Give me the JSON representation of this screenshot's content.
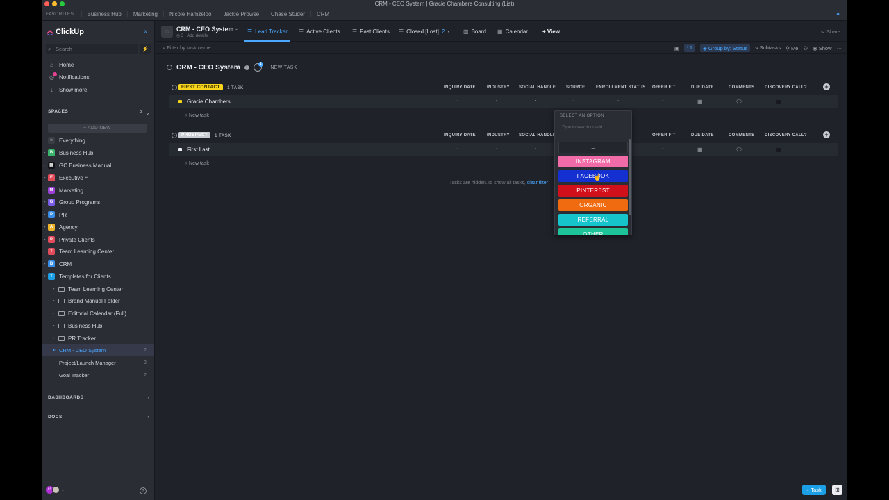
{
  "window_title": "CRM - CEO System | Gracie Chambers Consulting (List)",
  "favorites": {
    "label": "FAVORITES",
    "items": [
      "Business Hub",
      "Marketing",
      "Nicole Hamzeloo",
      "Jackie Prowse",
      "Chase Studer",
      "CRM"
    ]
  },
  "sidebar": {
    "logo": "ClickUp",
    "search_placeholder": "Search",
    "nav": [
      {
        "label": "Home",
        "icon": "home-icon"
      },
      {
        "label": "Notifications",
        "icon": "bell-icon"
      },
      {
        "label": "Show more",
        "icon": "chevron-down-icon"
      }
    ],
    "spaces_label": "SPACES",
    "add_new": "+ ADD NEW",
    "spaces": [
      {
        "label": "Everything",
        "badge": "",
        "color": "#393c44"
      },
      {
        "label": "Business Hub",
        "badge": "B",
        "color": "#3db46d"
      },
      {
        "label": "GC Business Manual",
        "badge": "",
        "color": "#1f2229"
      },
      {
        "label": "Executive",
        "badge": "E",
        "color": "#e24c5a"
      },
      {
        "label": "Marketing",
        "badge": "M",
        "color": "#9b3fd6"
      },
      {
        "label": "Group Programs",
        "badge": "G",
        "color": "#7b5ce6"
      },
      {
        "label": "PR",
        "badge": "P",
        "color": "#3a8ee6"
      },
      {
        "label": "Agency",
        "badge": "A",
        "color": "#f0b429"
      },
      {
        "label": "Private Clients",
        "badge": "P",
        "color": "#e24c5a"
      },
      {
        "label": "Team Learning Center",
        "badge": "T",
        "color": "#e24c5a"
      },
      {
        "label": "CRM",
        "badge": "B",
        "color": "#3a8ee6"
      },
      {
        "label": "Templates for Clients",
        "badge": "T",
        "color": "#1b9fe6"
      }
    ],
    "folders": [
      "Team Learning Center",
      "Brand Manual Folder",
      "Editorial Calendar (Full)",
      "Business Hub",
      "PR Tracker"
    ],
    "lists": [
      {
        "label": "CRM - CEO System",
        "count": "2"
      },
      {
        "label": "Project/Launch Manager",
        "count": "2"
      },
      {
        "label": "Goal Tracker",
        "count": "2"
      }
    ],
    "dashboards": "DASHBOARDS",
    "docs": "DOCS",
    "avatar": "G"
  },
  "topbar": {
    "title": "CRM - CEO System",
    "sub_count": "3",
    "sub_details": "Add details",
    "views": [
      {
        "label": "Lead Tracker",
        "icon": "list-icon"
      },
      {
        "label": "Active Clients",
        "icon": "list-icon"
      },
      {
        "label": "Past Clients",
        "icon": "list-icon"
      },
      {
        "label": "Closed [Lost]",
        "icon": "list-icon"
      },
      {
        "label": "Board",
        "icon": "board-icon"
      },
      {
        "label": "Calendar",
        "icon": "calendar-icon"
      }
    ],
    "closed_count": "2",
    "add_view": "+ View",
    "share": "Share"
  },
  "filterbar": {
    "placeholder": "Filter by task name...",
    "filter_count": "1",
    "group_by": "Group by: Status",
    "subtasks": "Subtasks",
    "me": "Me",
    "show": "Show"
  },
  "list": {
    "title": "CRM - CEO System",
    "watchers": "1",
    "new_task": "+ NEW TASK",
    "columns": [
      "INQUIRY DATE",
      "INDUSTRY",
      "SOCIAL HANDLE",
      "SOURCE",
      "ENROLLMENT STATUS",
      "OFFER FIT",
      "DUE DATE",
      "COMMENTS",
      "DISCOVERY CALL?"
    ],
    "groups": [
      {
        "status": "FIRST CONTACT",
        "color": "#f7d51d",
        "text_color": "#3a3000",
        "count": "1 TASK",
        "task": "Gracie Chambers",
        "task_color": "#f7d51d"
      },
      {
        "status": "PROSPECT",
        "color": "#c8cbd1",
        "text_color": "#ffffff",
        "count": "1 TASK",
        "task": "First Last",
        "task_color": "#eceef1"
      }
    ],
    "new_task_row": "+ New task",
    "hidden_note": "Tasks are hidden.To show all tasks,",
    "clear_filter": "clear filter",
    "dash": "-"
  },
  "dropdown": {
    "title": "SELECT AN OPTION",
    "placeholder": "Type to search or add...",
    "none_option": "–",
    "options": [
      {
        "label": "INSTAGRAM",
        "color": "#f06ba8"
      },
      {
        "label": "FACEBOOK",
        "color": "#1530d0"
      },
      {
        "label": "PINTEREST",
        "color": "#d0101a"
      },
      {
        "label": "ORGANIC",
        "color": "#f06a0f"
      },
      {
        "label": "REFERRAL",
        "color": "#16c5cc"
      },
      {
        "label": "OTHER",
        "color": "#1dc49a"
      }
    ]
  },
  "fab": {
    "task": "+ Task"
  }
}
